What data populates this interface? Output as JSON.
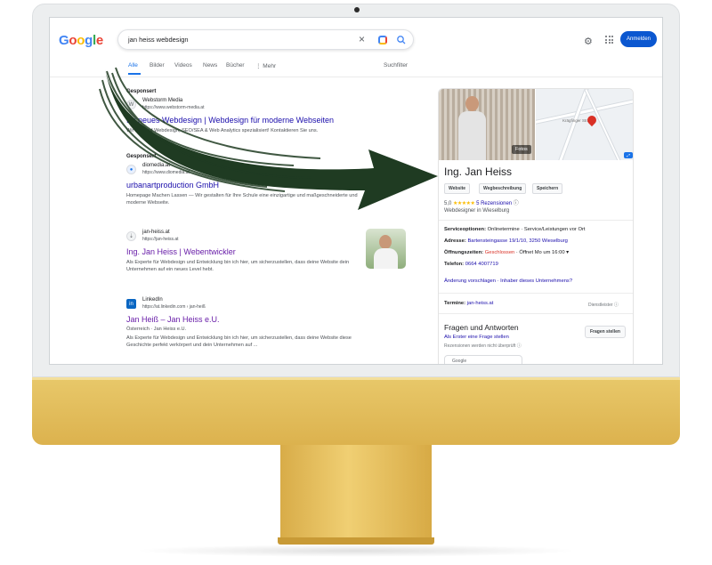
{
  "search": {
    "query": "jan heiss webdesign",
    "signin_label": "Anmelden"
  },
  "tabs": [
    "Alle",
    "Bilder",
    "Videos",
    "News",
    "Bücher",
    "⋮ Mehr"
  ],
  "tools_label": "Suchfilter",
  "results": {
    "ad1": {
      "sponsor_label": "Gesponsert",
      "site_name": "Webstorm Media",
      "url": "https://www.webstorm-media.at",
      "title": "Ihr neues Webdesign | Webdesign für moderne Webseiten",
      "snippet": "Wir sind auf Webdesign, SEO/SEA & Web Analytics spezialisiert! Kontaktieren Sie uns."
    },
    "ad2": {
      "sponsor_label": "Gesponsert",
      "site_name": "diomedia.at",
      "url": "https://www.diomedia.at",
      "title": "urbanartproduction GmbH",
      "snippet": "Homepage Machen Lassen — Wir gestalten für Ihre Schule eine einzigartige und maßgeschneiderte und moderne Webseite."
    },
    "r1": {
      "site_name": "jan-heiss.at",
      "url": "https://jan-heiss.at",
      "title": "Ing. Jan Heiss | Webentwickler",
      "snippet": "Als Experte für Webdesign und Entwicklung bin ich hier, um sicherzustellen, dass deine Website dein Unternehmen auf ein neues Level hebt."
    },
    "r2": {
      "site_name": "LinkedIn",
      "url": "https://at.linkedin.com › jan-heiß",
      "title": "Jan Heiß – Jan Heiss e.U.",
      "subtitle": "Österreich · Jan Heiss e.U.",
      "snippet": "Als Experte für Webdesign und Entwicklung bin ich hier, um sicherzustellen, dass deine Website diese Geschichte perfekt verkörpert und dein Unternehmen auf ..."
    }
  },
  "panel": {
    "fotos_label": "Fotos",
    "map_street": "Krägfinger Straße",
    "name": "Ing. Jan Heiss",
    "btn_website": "Website",
    "btn_route": "Wegbeschreibung",
    "btn_save": "Speichern",
    "rating": "5,0",
    "reviews": "5 Rezensionen",
    "category": "Webdesigner in Wieselburg",
    "service_label": "Serviceoptionen:",
    "service_value": "Onlinetermine · Service/Leistungen vor Ort",
    "address_label": "Adresse:",
    "address_value": "Bartensteingasse 19/1/10, 3250 Wieselburg",
    "hours_label": "Öffnungszeiten:",
    "hours_closed": "Geschlossen",
    "hours_next": "· Öffnet Mo um 16:00 ▾",
    "phone_label": "Telefon:",
    "phone_value": "0664 4007719",
    "suggest_link": "Änderung vorschlagen · Inhaber dieses Unternehmens?",
    "appointments_label": "Termine:",
    "appointments_value": "jan-heiss.at",
    "provider_label": "Dienstleister ⓘ",
    "qa_title": "Fragen und Antworten",
    "qa_link": "Als Erster eine Frage stellen",
    "qa_note": "Rezensionen werden nicht überprüft ⓘ",
    "ask_button": "Fragen stellen",
    "bottom_box": "Google"
  }
}
